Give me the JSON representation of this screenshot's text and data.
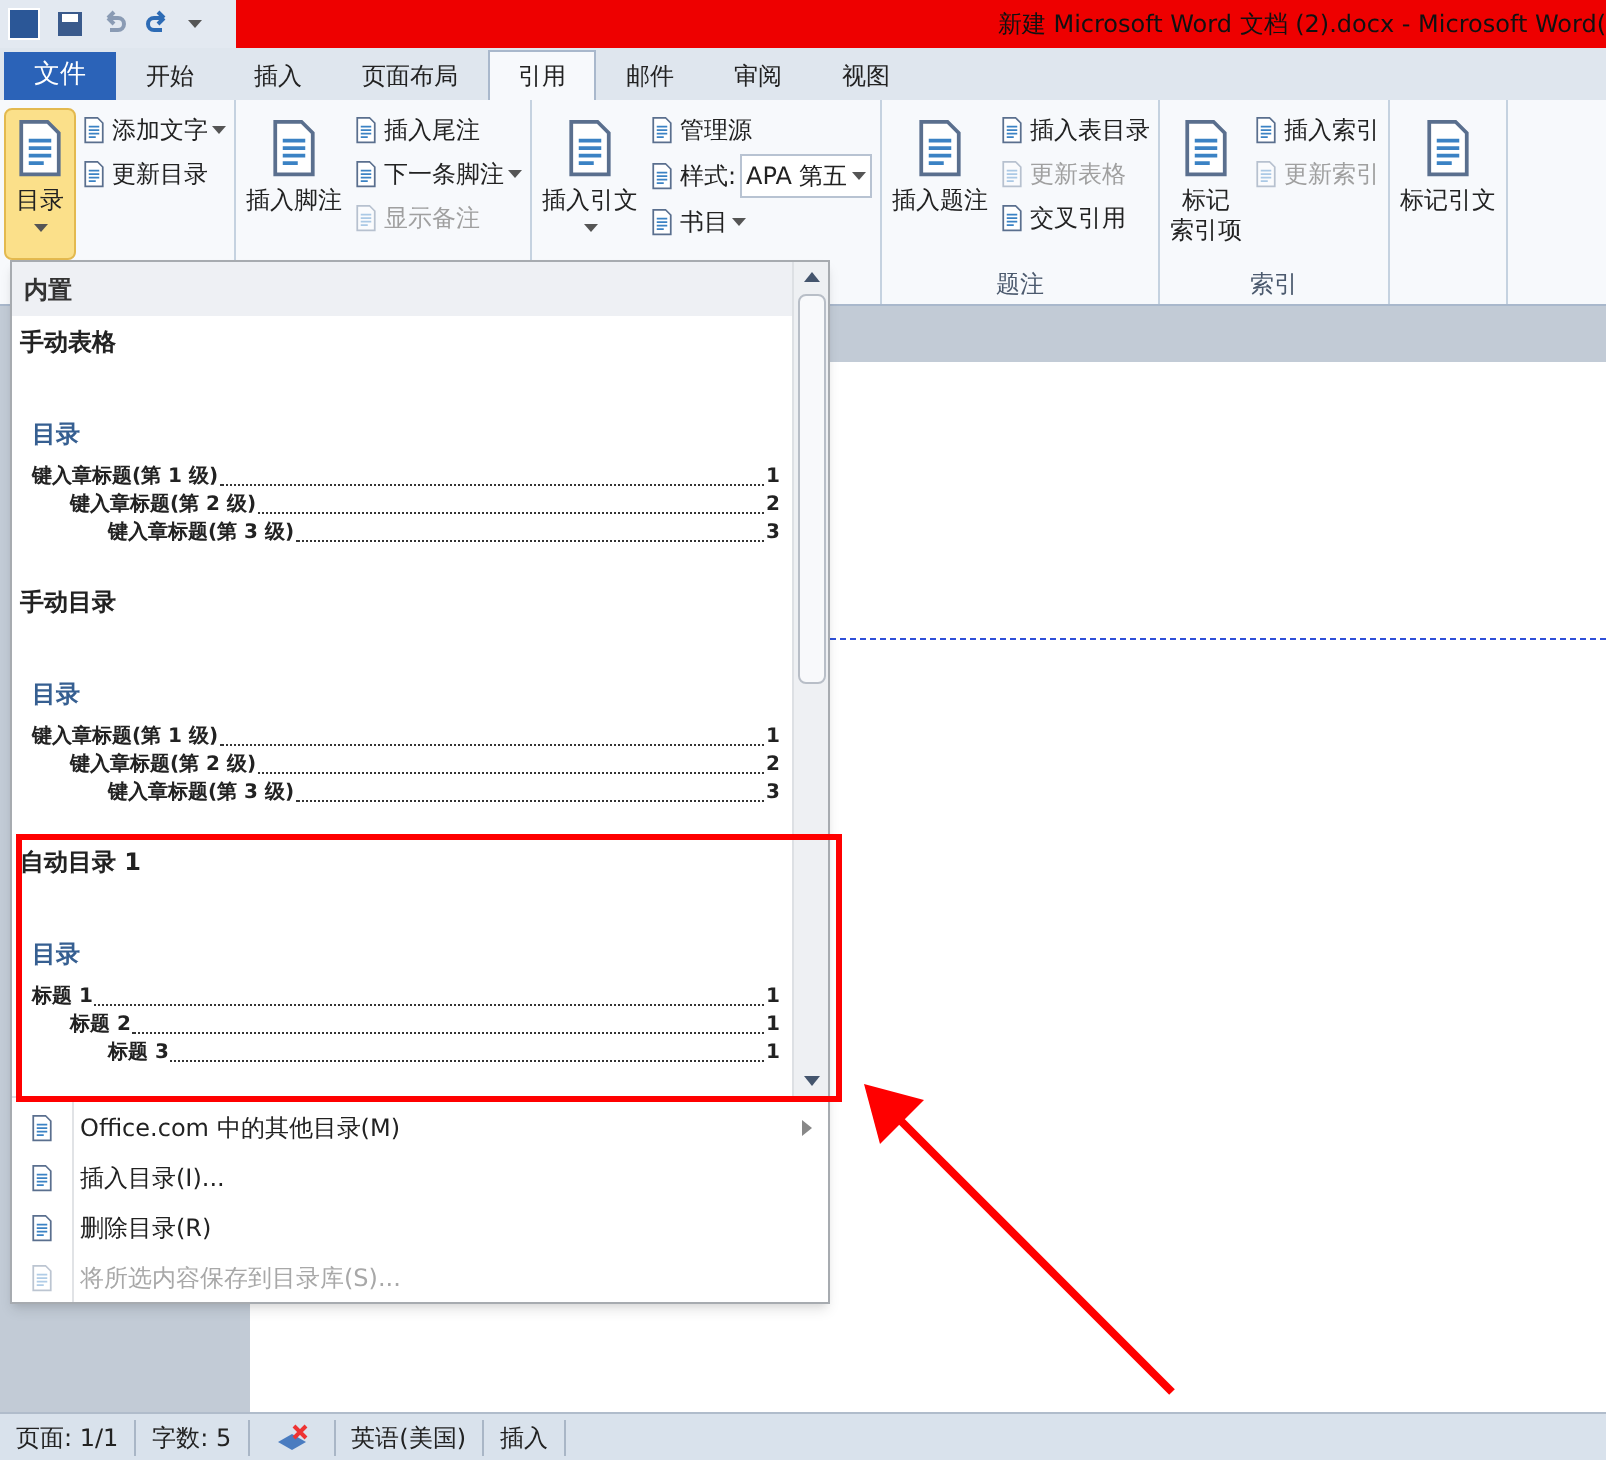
{
  "window": {
    "title": "新建 Microsoft Word 文档 (2).docx - Microsoft Word("
  },
  "ribbon_tabs": [
    {
      "label": "文件",
      "kind": "file",
      "selected": false
    },
    {
      "label": "开始",
      "kind": "tab",
      "selected": false
    },
    {
      "label": "插入",
      "kind": "tab",
      "selected": false
    },
    {
      "label": "页面布局",
      "kind": "tab",
      "selected": false
    },
    {
      "label": "引用",
      "kind": "tab",
      "selected": true
    },
    {
      "label": "邮件",
      "kind": "tab",
      "selected": false
    },
    {
      "label": "审阅",
      "kind": "tab",
      "selected": false
    },
    {
      "label": "视图",
      "kind": "tab",
      "selected": false
    }
  ],
  "ribbon_groups": [
    {
      "items": [
        {
          "kind": "large",
          "label": "目录",
          "dropdown": true,
          "active": true
        },
        {
          "kind": "small",
          "label": "添加文字",
          "dropdown": true,
          "disabled": false
        },
        {
          "kind": "small",
          "label": "更新目录",
          "dropdown": false,
          "disabled": false
        }
      ]
    },
    {
      "items": [
        {
          "kind": "large",
          "label": "插入脚注",
          "dropdown": false,
          "active": false
        },
        {
          "kind": "small",
          "label": "插入尾注",
          "dropdown": false,
          "disabled": false
        },
        {
          "kind": "small",
          "label": "下一条脚注",
          "dropdown": true,
          "disabled": false
        },
        {
          "kind": "small",
          "label": "显示备注",
          "dropdown": false,
          "disabled": true
        }
      ]
    },
    {
      "items": [
        {
          "kind": "large",
          "label": "插入引文",
          "dropdown": true,
          "active": false
        },
        {
          "kind": "small",
          "label": "管理源",
          "dropdown": false,
          "disabled": false
        },
        {
          "kind": "field",
          "label": "样式:",
          "value": "APA 第五"
        },
        {
          "kind": "small",
          "label": "书目",
          "dropdown": true,
          "disabled": false
        }
      ]
    },
    {
      "label": "题注",
      "items": [
        {
          "kind": "large",
          "label": "插入题注",
          "dropdown": false,
          "active": false
        },
        {
          "kind": "small",
          "label": "插入表目录",
          "dropdown": false,
          "disabled": false
        },
        {
          "kind": "small",
          "label": "更新表格",
          "dropdown": false,
          "disabled": true
        },
        {
          "kind": "small",
          "label": "交叉引用",
          "dropdown": false,
          "disabled": false
        }
      ]
    },
    {
      "label": "索引",
      "items": [
        {
          "kind": "large",
          "label_lines": [
            "标记",
            "索引项"
          ],
          "dropdown": false,
          "active": false
        },
        {
          "kind": "small",
          "label": "插入索引",
          "dropdown": false,
          "disabled": false
        },
        {
          "kind": "small",
          "label": "更新索引",
          "dropdown": false,
          "disabled": true
        }
      ]
    },
    {
      "items": [
        {
          "kind": "large",
          "label": "标记引文",
          "dropdown": false,
          "active": false
        }
      ]
    }
  ],
  "toc_menu": {
    "header": "内置",
    "gallery": [
      {
        "title": "手动表格",
        "toc_heading": "目录",
        "lines": [
          {
            "text": "键入章标题(第 1 级)",
            "page": "1",
            "children": [
              {
                "text": "键入章标题(第 2 级)",
                "page": "2",
                "children": [
                  {
                    "text": "键入章标题(第 3 级)",
                    "page": "3"
                  }
                ]
              }
            ]
          }
        ]
      },
      {
        "title": "手动目录",
        "toc_heading": "目录",
        "lines": [
          {
            "text": "键入章标题(第 1 级)",
            "page": "1",
            "children": [
              {
                "text": "键入章标题(第 2 级)",
                "page": "2",
                "children": [
                  {
                    "text": "键入章标题(第 3 级)",
                    "page": "3"
                  }
                ]
              }
            ]
          }
        ]
      },
      {
        "title": "自动目录 1",
        "toc_heading": "目录",
        "lines": [
          {
            "text": "标题 1",
            "page": "1",
            "children": [
              {
                "text": "标题 2",
                "page": "1",
                "children": [
                  {
                    "text": "标题 3",
                    "page": "1"
                  }
                ]
              }
            ]
          }
        ]
      }
    ],
    "items": [
      {
        "label": "Office.com 中的其他目录(M)",
        "submenu": true,
        "disabled": false
      },
      {
        "label": "插入目录(I)...",
        "submenu": false,
        "disabled": false
      },
      {
        "label": "删除目录(R)",
        "submenu": false,
        "disabled": false
      },
      {
        "label": "将所选内容保存到目录库(S)...",
        "submenu": false,
        "disabled": true
      }
    ]
  },
  "status_bar": {
    "page": "页面: 1/1",
    "words": "字数: 5",
    "language": "英语(美国)",
    "mode": "插入"
  }
}
